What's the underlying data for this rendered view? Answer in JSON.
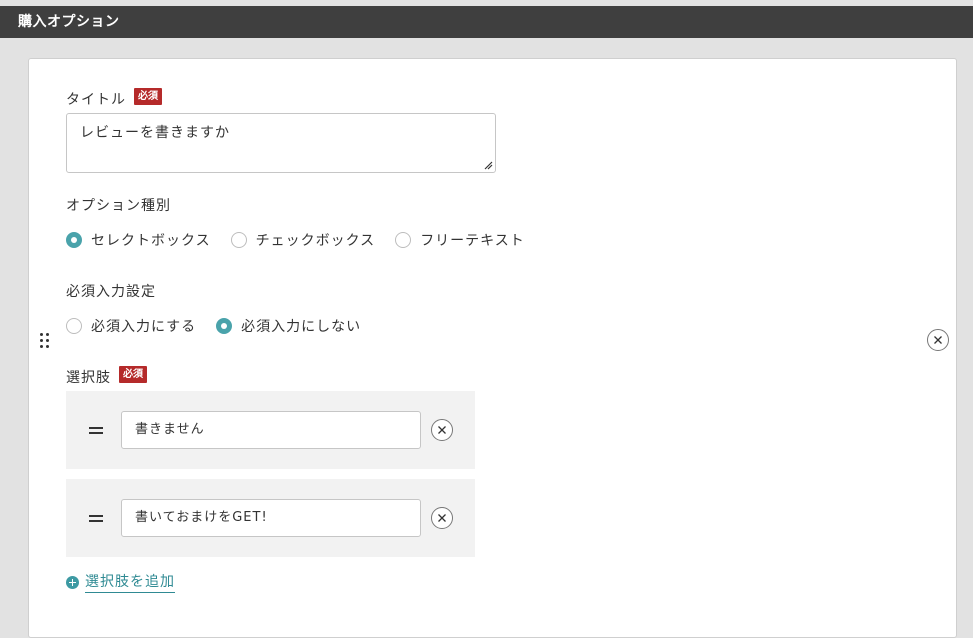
{
  "section": {
    "title": "購入オプション"
  },
  "title_field": {
    "label": "タイトル",
    "required_badge": "必須",
    "value": "レビューを書きますか"
  },
  "option_type": {
    "label": "オプション種別",
    "options": [
      {
        "label": "セレクトボックス",
        "checked": true
      },
      {
        "label": "チェックボックス",
        "checked": false
      },
      {
        "label": "フリーテキスト",
        "checked": false
      }
    ]
  },
  "required_setting": {
    "label": "必須入力設定",
    "options": [
      {
        "label": "必須入力にする",
        "checked": false
      },
      {
        "label": "必須入力にしない",
        "checked": true
      }
    ]
  },
  "choices": {
    "label": "選択肢",
    "required_badge": "必須",
    "items": [
      {
        "value": "書きません"
      },
      {
        "value": "書いておまけをGET!"
      }
    ],
    "add_label": "選択肢を追加"
  },
  "colors": {
    "accent": "#4aa3ab",
    "header_bg": "#3f3f3f",
    "required_badge": "#b52a2a",
    "link": "#2f8a93"
  }
}
